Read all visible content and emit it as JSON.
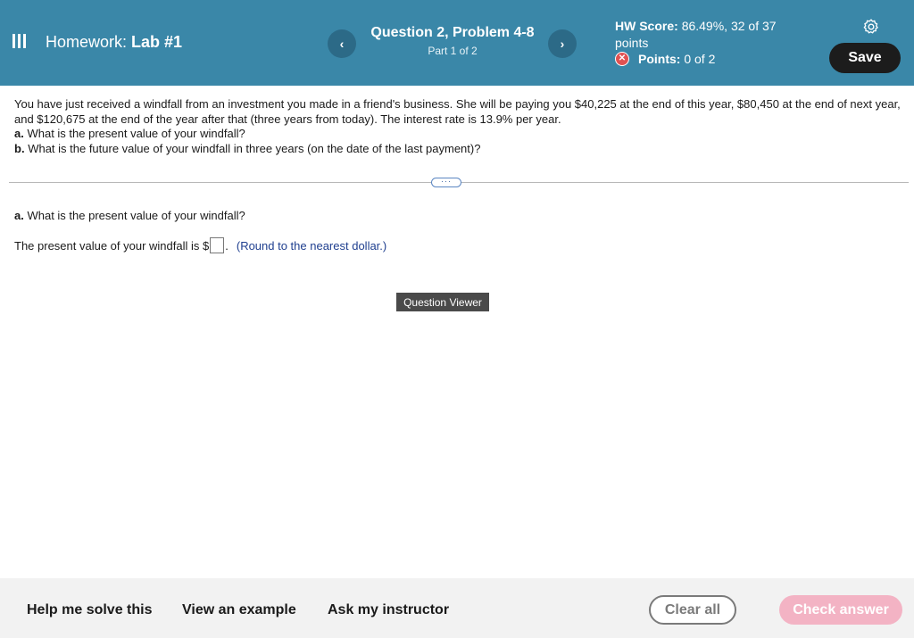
{
  "header": {
    "menu_icon": "hamburger-menu-icon",
    "homework_prefix": "Homework:",
    "homework_name": "Lab #1",
    "question_title": "Question 2, Problem 4-8",
    "question_part": "Part 1 of 2",
    "prev_label": "‹",
    "next_label": "›",
    "score_label": "HW Score:",
    "score_value": "86.49%, 32 of 37 points",
    "points_label": "Points:",
    "points_value": "0 of 2",
    "points_icon": "x-circle-icon",
    "settings_icon": "gear-icon",
    "save_label": "Save"
  },
  "problem": {
    "intro": "You have just received a windfall from an investment you made in a friend's business. She will be paying you $40,225 at the end of this year, $80,450 at the end of next year, and $120,675 at the end of the year after that (three years from today). The interest rate is 13.9% per year.",
    "a_label": "a.",
    "a_text": "What is the present value of your windfall?",
    "b_label": "b.",
    "b_text": "What is the future value of your windfall in three years (on the date of the last payment)?"
  },
  "expand_label": "···",
  "part_a": {
    "label": "a.",
    "question": "What is the present value of your windfall?",
    "answer_prefix": "The present value of your windfall is $",
    "answer_value": "",
    "answer_suffix": ".",
    "hint": "(Round to the nearest dollar.)"
  },
  "question_viewer_label": "Question Viewer",
  "footer": {
    "help_solve": "Help me solve this",
    "view_example": "View an example",
    "ask_instructor": "Ask my instructor",
    "clear_all": "Clear all",
    "check_answer": "Check answer"
  },
  "colors": {
    "header_bg": "#3a87a8",
    "nav_btn_bg": "#2c6a87",
    "save_bg": "#1c1c1c",
    "points_icon": "#e05252",
    "hint_text": "#1f3f8f",
    "check_answer_bg": "#f3b3c4"
  }
}
